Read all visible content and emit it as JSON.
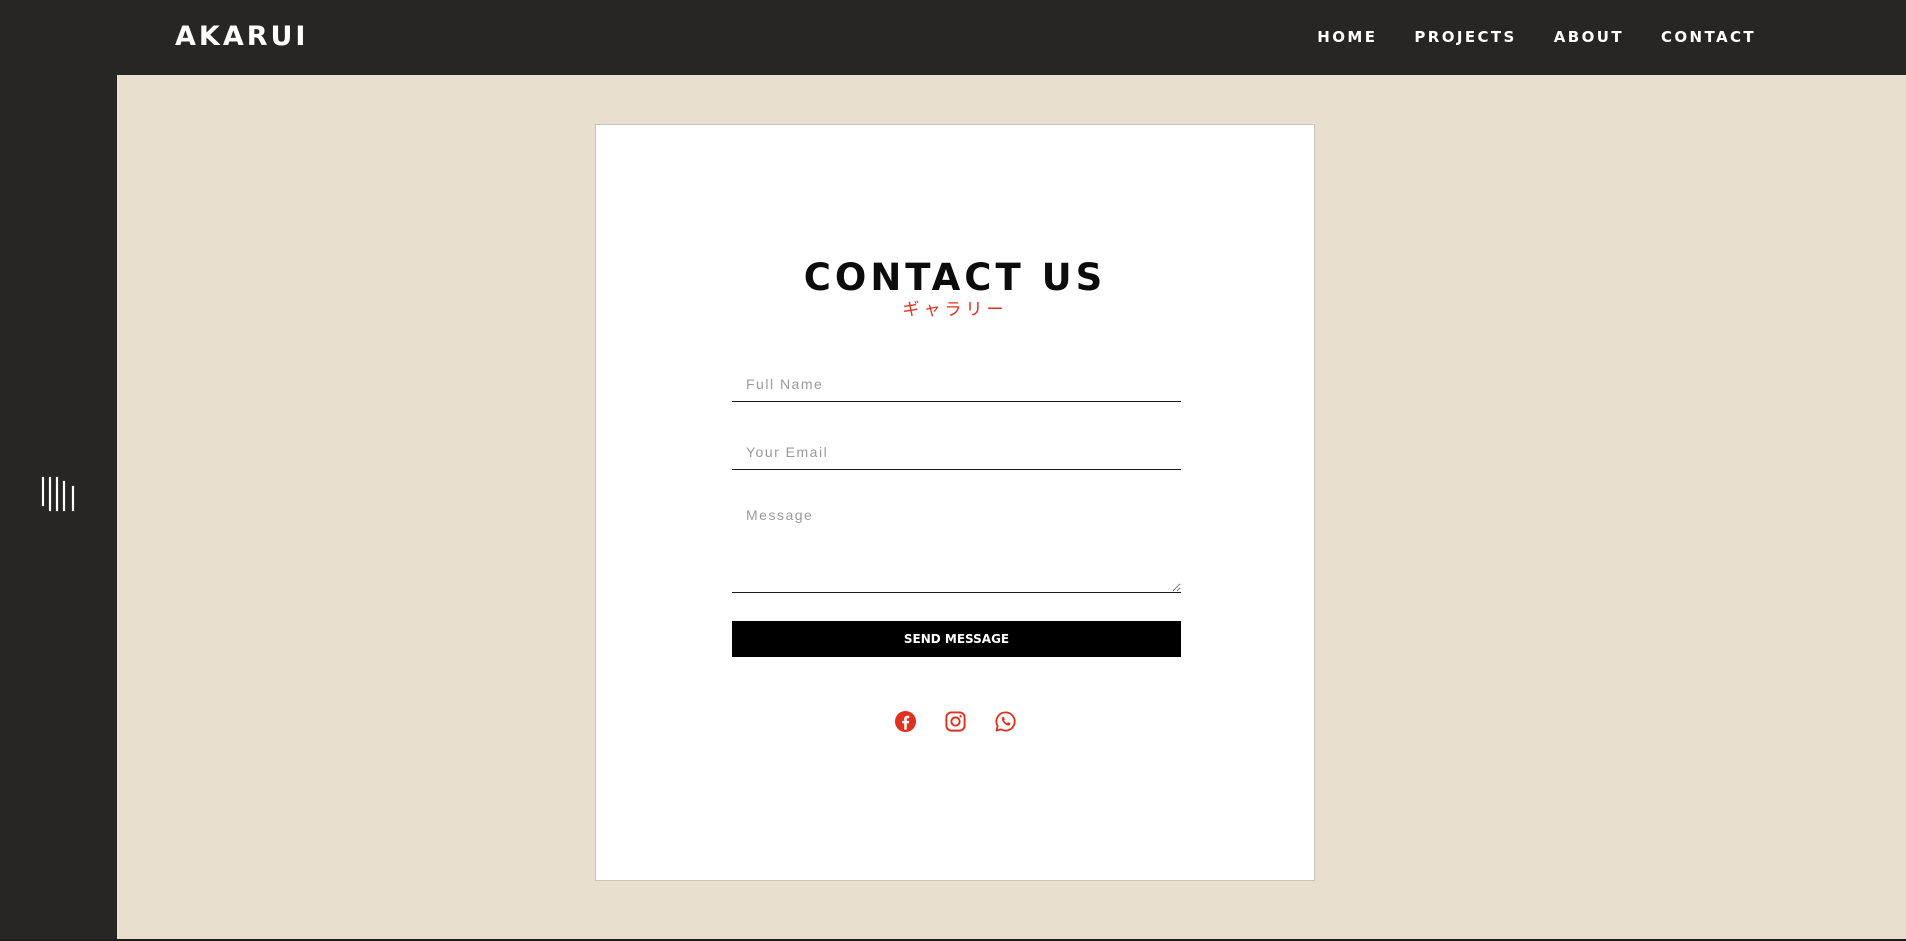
{
  "header": {
    "logo": "AKARUI",
    "nav": [
      "HOME",
      "PROJECTS",
      "ABOUT",
      "CONTACT"
    ]
  },
  "sidebar": {
    "menu_icon": "vertical-bars-icon"
  },
  "contact": {
    "title": "CONTACT US",
    "subtitle": "ギャラリー",
    "fields": {
      "name_placeholder": "Full Name",
      "email_placeholder": "Your Email",
      "message_placeholder": "Message"
    },
    "send_label": "SEND MESSAGE",
    "socials": [
      "facebook-icon",
      "instagram-icon",
      "whatsapp-icon"
    ]
  },
  "colors": {
    "dark": "#282625",
    "background": "#e9dfcf",
    "accent": "#e0301e",
    "card": "#ffffff",
    "button": "#000000"
  }
}
